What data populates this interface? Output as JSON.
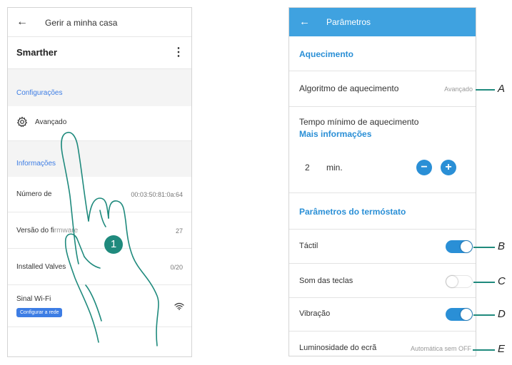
{
  "left_screen": {
    "back_icon": "arrow-left-icon",
    "title": "Gerir a minha casa",
    "device_name": "Smarther",
    "menu_icon": "kebab-menu-icon",
    "section_config": "Configurações",
    "advanced": {
      "icon": "gear-icon",
      "label": "Avançado"
    },
    "section_info": "Informações",
    "rows": [
      {
        "label": "Número de",
        "value": "00:03:50:81:0a:64"
      },
      {
        "label": "Versão do fi",
        "label_tail": "rmware",
        "value": "27"
      },
      {
        "label": "Installed Valves",
        "value": "0/20"
      }
    ],
    "wifi": {
      "label": "Sinal Wi-Fi",
      "chip": "Configurar a rede",
      "icon": "wifi-icon"
    },
    "step_badge": "1"
  },
  "right_screen": {
    "back_icon": "arrow-left-icon",
    "title": "Parâmetros",
    "section_heating": "Aquecimento",
    "algorithm": {
      "label": "Algoritmo de aquecimento",
      "value": "Avançado"
    },
    "min_time": {
      "label": "Tempo mínimo de aquecimento",
      "link": "Mais informações",
      "value": "2",
      "unit": "min."
    },
    "section_thermostat": "Parâmetros do termóstato",
    "touch": {
      "label": "Táctil",
      "on": true
    },
    "key_sound": {
      "label": "Som das teclas",
      "on": false
    },
    "vibration": {
      "label": "Vibração",
      "on": true
    },
    "brightness": {
      "label": "Luminosidade do ecrã",
      "value": "Automática sem OFF"
    }
  },
  "callouts": [
    "A",
    "B",
    "C",
    "D",
    "E"
  ],
  "colors": {
    "accent": "#2a8fd6",
    "header": "#3fa2e0",
    "callout": "#1f8a7d",
    "link_left": "#3d7de4"
  }
}
